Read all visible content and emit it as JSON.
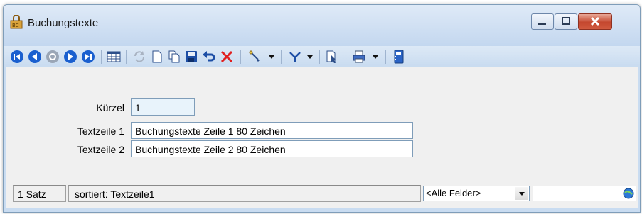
{
  "window": {
    "title": "Buchungstexte"
  },
  "toolbar": {
    "icons": [
      "first-record-icon",
      "prev-record-icon",
      "refresh-nav-icon",
      "next-record-icon",
      "last-record-icon",
      "table-view-icon",
      "reload-icon",
      "new-record-icon",
      "copy-record-icon",
      "save-icon",
      "undo-icon",
      "delete-icon",
      "edit-tool-icon",
      "filter-icon",
      "search-record-icon",
      "print-icon",
      "book-icon"
    ]
  },
  "form": {
    "kuerzel_label": "Kürzel",
    "kuerzel_value": "1",
    "textzeile1_label": "Textzeile 1",
    "textzeile1_value": "Buchungstexte Zeile 1 80 Zeichen",
    "textzeile2_label": "Textzeile 2",
    "textzeile2_value": "Buchungstexte Zeile 2 80 Zeichen"
  },
  "status": {
    "count": "1 Satz",
    "sort": "sortiert: Textzeile1",
    "field_filter": "<Alle Felder>",
    "search_value": ""
  },
  "colors": {
    "nav_blue": "#1a5fcf",
    "delete_red": "#e02020",
    "field_highlight": "#e8f3fb"
  }
}
